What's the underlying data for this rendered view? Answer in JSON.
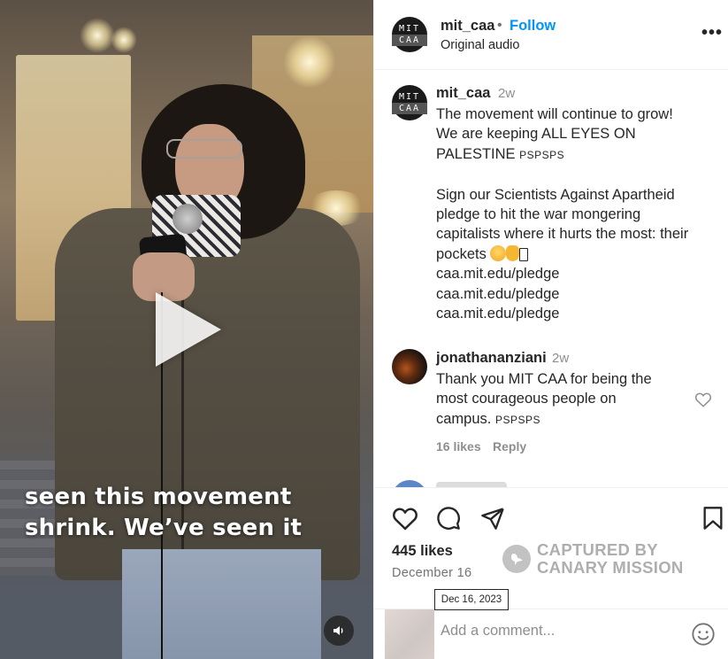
{
  "media": {
    "caption_lines": [
      "seen this movement",
      "shrink. We’ve seen it"
    ],
    "play_icon": "play-icon",
    "audio_icon": "speaker-icon"
  },
  "header": {
    "avatar_top": "MIT",
    "avatar_bottom": "CAA",
    "username": "mit_caa",
    "separator": "•",
    "follow_label": "Follow",
    "audio_label": "Original audio",
    "more_label": "•••"
  },
  "caption": {
    "avatar_top": "MIT",
    "avatar_bottom": "CAA",
    "username": "mit_caa",
    "time": "2w",
    "lines": [
      "The movement will continue to grow!",
      "We are keeping ALL EYES ON",
      "PALESTINE"
    ],
    "tag": "PSPSPS",
    "para2_lines": [
      "Sign our Scientists Against Apartheid",
      "pledge to hit the war mongering",
      "capitalists where it hurts the most: their",
      "pockets"
    ],
    "links": [
      "caa.mit.edu/pledge",
      "caa.mit.edu/pledge",
      "caa.mit.edu/pledge"
    ]
  },
  "reply": {
    "username": "jonathananziani",
    "time": "2w",
    "lines": [
      "Thank you MIT CAA for being the",
      "most courageous people on",
      "campus."
    ],
    "tag": "PSPSPS",
    "likes": "16 likes",
    "reply_label": "Reply"
  },
  "actions": {
    "likes": "445 likes",
    "date": "December 16",
    "tooltip": "Dec 16, 2023",
    "watermark_line1": "CAPTURED BY",
    "watermark_line2": "CANARY MISSION",
    "comment_placeholder": "Add a comment..."
  },
  "colors": {
    "accent": "#0095f6",
    "text": "#262626",
    "muted": "#8e8e8e"
  }
}
